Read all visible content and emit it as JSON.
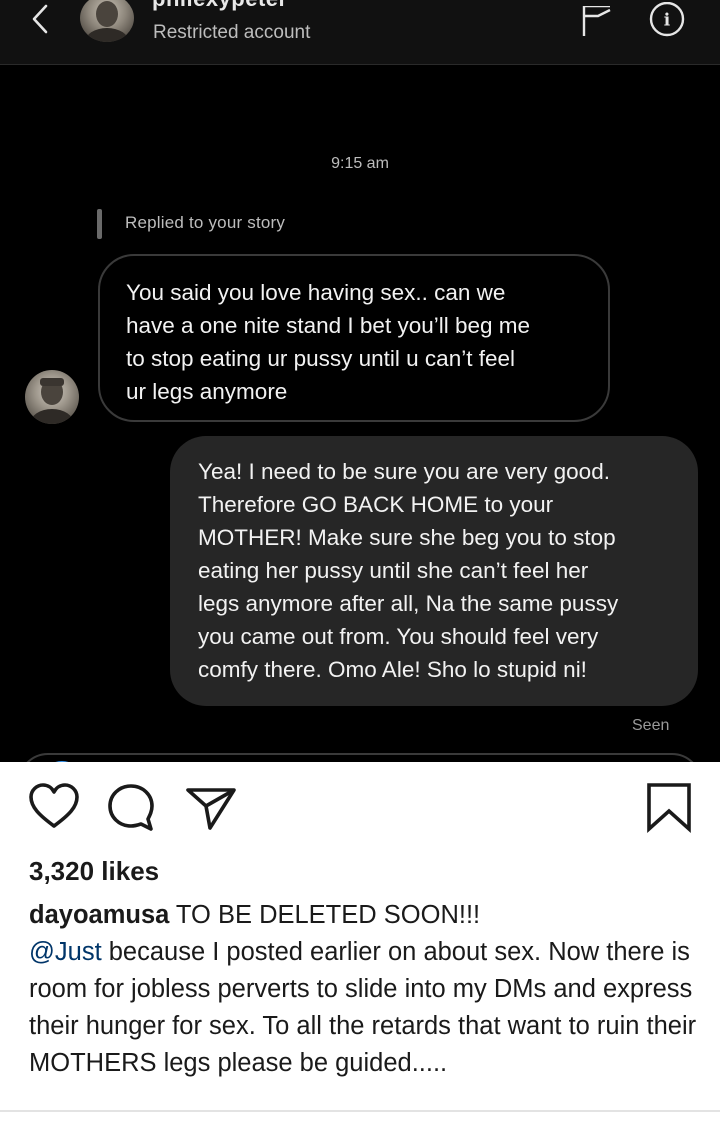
{
  "dm": {
    "username": "philexypeter",
    "subtitle": "Restricted account",
    "timestamp": "9:15 am",
    "reply_label": "Replied to your story",
    "incoming_message": "You said you love having sex.. can we\nhave a one nite stand I bet you’ll beg me\nto stop eating ur pussy until u can’t feel\nur legs anymore",
    "outgoing_message": "Yea! I need to be sure you are very good.\nTherefore GO BACK HOME to your\nMOTHER! Make sure she beg you to stop\neating her pussy until she can’t feel her\nlegs anymore after all, Na the same pussy\nyou came out from. You should feel very\ncomfy there. Omo Ale! Sho lo stupid ni!",
    "seen_label": "Seen",
    "colors": {
      "background": "#000000",
      "header": "#111111",
      "outgoing_bubble": "#262626",
      "incoming_border": "#3a3a3a"
    }
  },
  "post": {
    "likes": "3,320 likes",
    "caption_user": "dayoamusa",
    "caption_title": " TO BE DELETED SOON!!!",
    "caption_mention": "@Just",
    "caption_body": " because I posted earlier on about sex. Now there is room for jobless perverts to slide into my DMs and express their hunger for sex. To all the retards that want to ruin their MOTHERS legs please be guided.....",
    "icons": [
      "heart-icon",
      "comment-icon",
      "share-icon",
      "bookmark-icon"
    ],
    "colors": {
      "text": "#1a1a1a",
      "mention": "#003569"
    }
  }
}
